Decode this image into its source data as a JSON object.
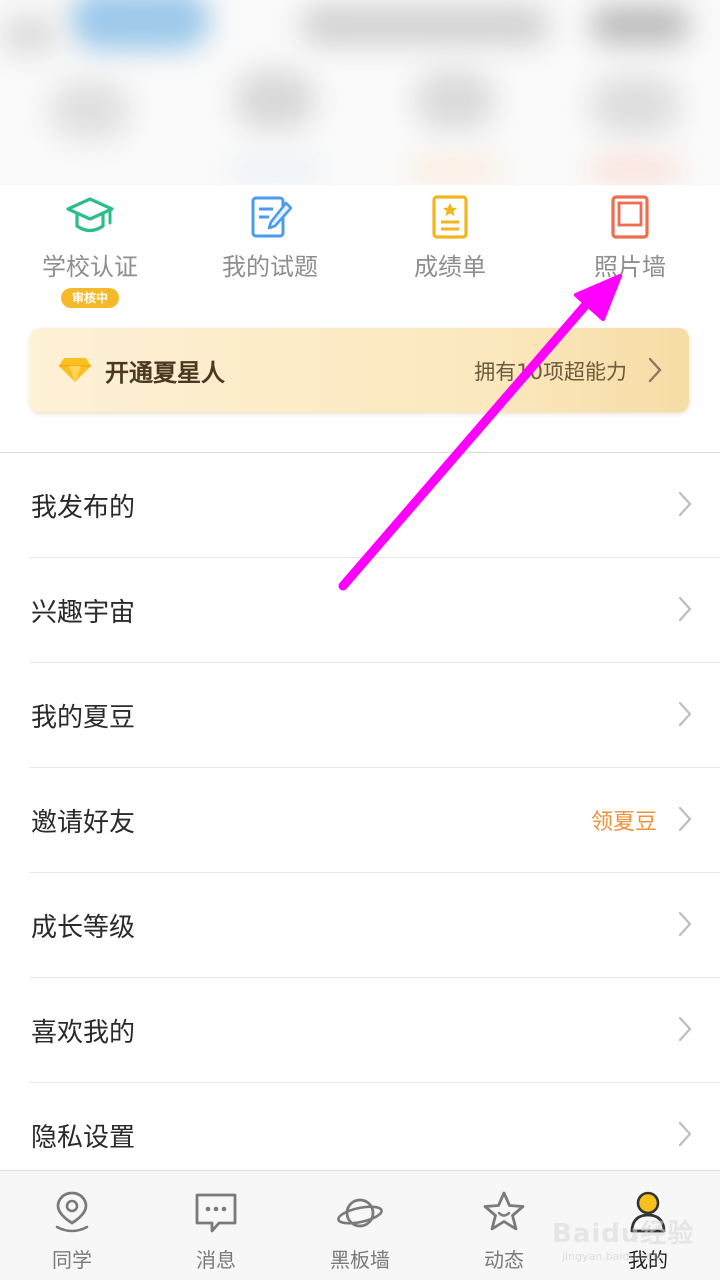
{
  "quick_actions": [
    {
      "label": "学校认证",
      "icon": "graduation-cap-icon",
      "badge": "审核中",
      "color": "#2dbd8a"
    },
    {
      "label": "我的试题",
      "icon": "pencil-paper-icon",
      "color": "#4a9af0"
    },
    {
      "label": "成绩单",
      "icon": "transcript-icon",
      "color": "#f2b51c"
    },
    {
      "label": "照片墙",
      "icon": "photo-frame-icon",
      "color": "#ef6d4e"
    }
  ],
  "vip": {
    "title": "开通夏星人",
    "subtitle": "拥有10项超能力",
    "icon": "diamond-icon"
  },
  "menu": [
    {
      "label": "我发布的"
    },
    {
      "label": "兴趣宇宙"
    },
    {
      "label": "我的夏豆"
    },
    {
      "label": "邀请好友",
      "extra": "领夏豆"
    },
    {
      "label": "成长等级"
    },
    {
      "label": "喜欢我的"
    },
    {
      "label": "隐私设置"
    }
  ],
  "nav": [
    {
      "label": "同学",
      "icon": "location-pin-icon"
    },
    {
      "label": "消息",
      "icon": "chat-bubble-icon"
    },
    {
      "label": "黑板墙",
      "icon": "planet-icon"
    },
    {
      "label": "动态",
      "icon": "star-icon"
    },
    {
      "label": "我的",
      "icon": "profile-icon",
      "active": true
    }
  ],
  "watermark": {
    "brand": "Baidu经验",
    "url": "jingyan.baidu.com"
  },
  "colors": {
    "accent_orange": "#f0903a",
    "badge_yellow": "#f6b92a",
    "arrow_magenta": "#ff00ff"
  }
}
